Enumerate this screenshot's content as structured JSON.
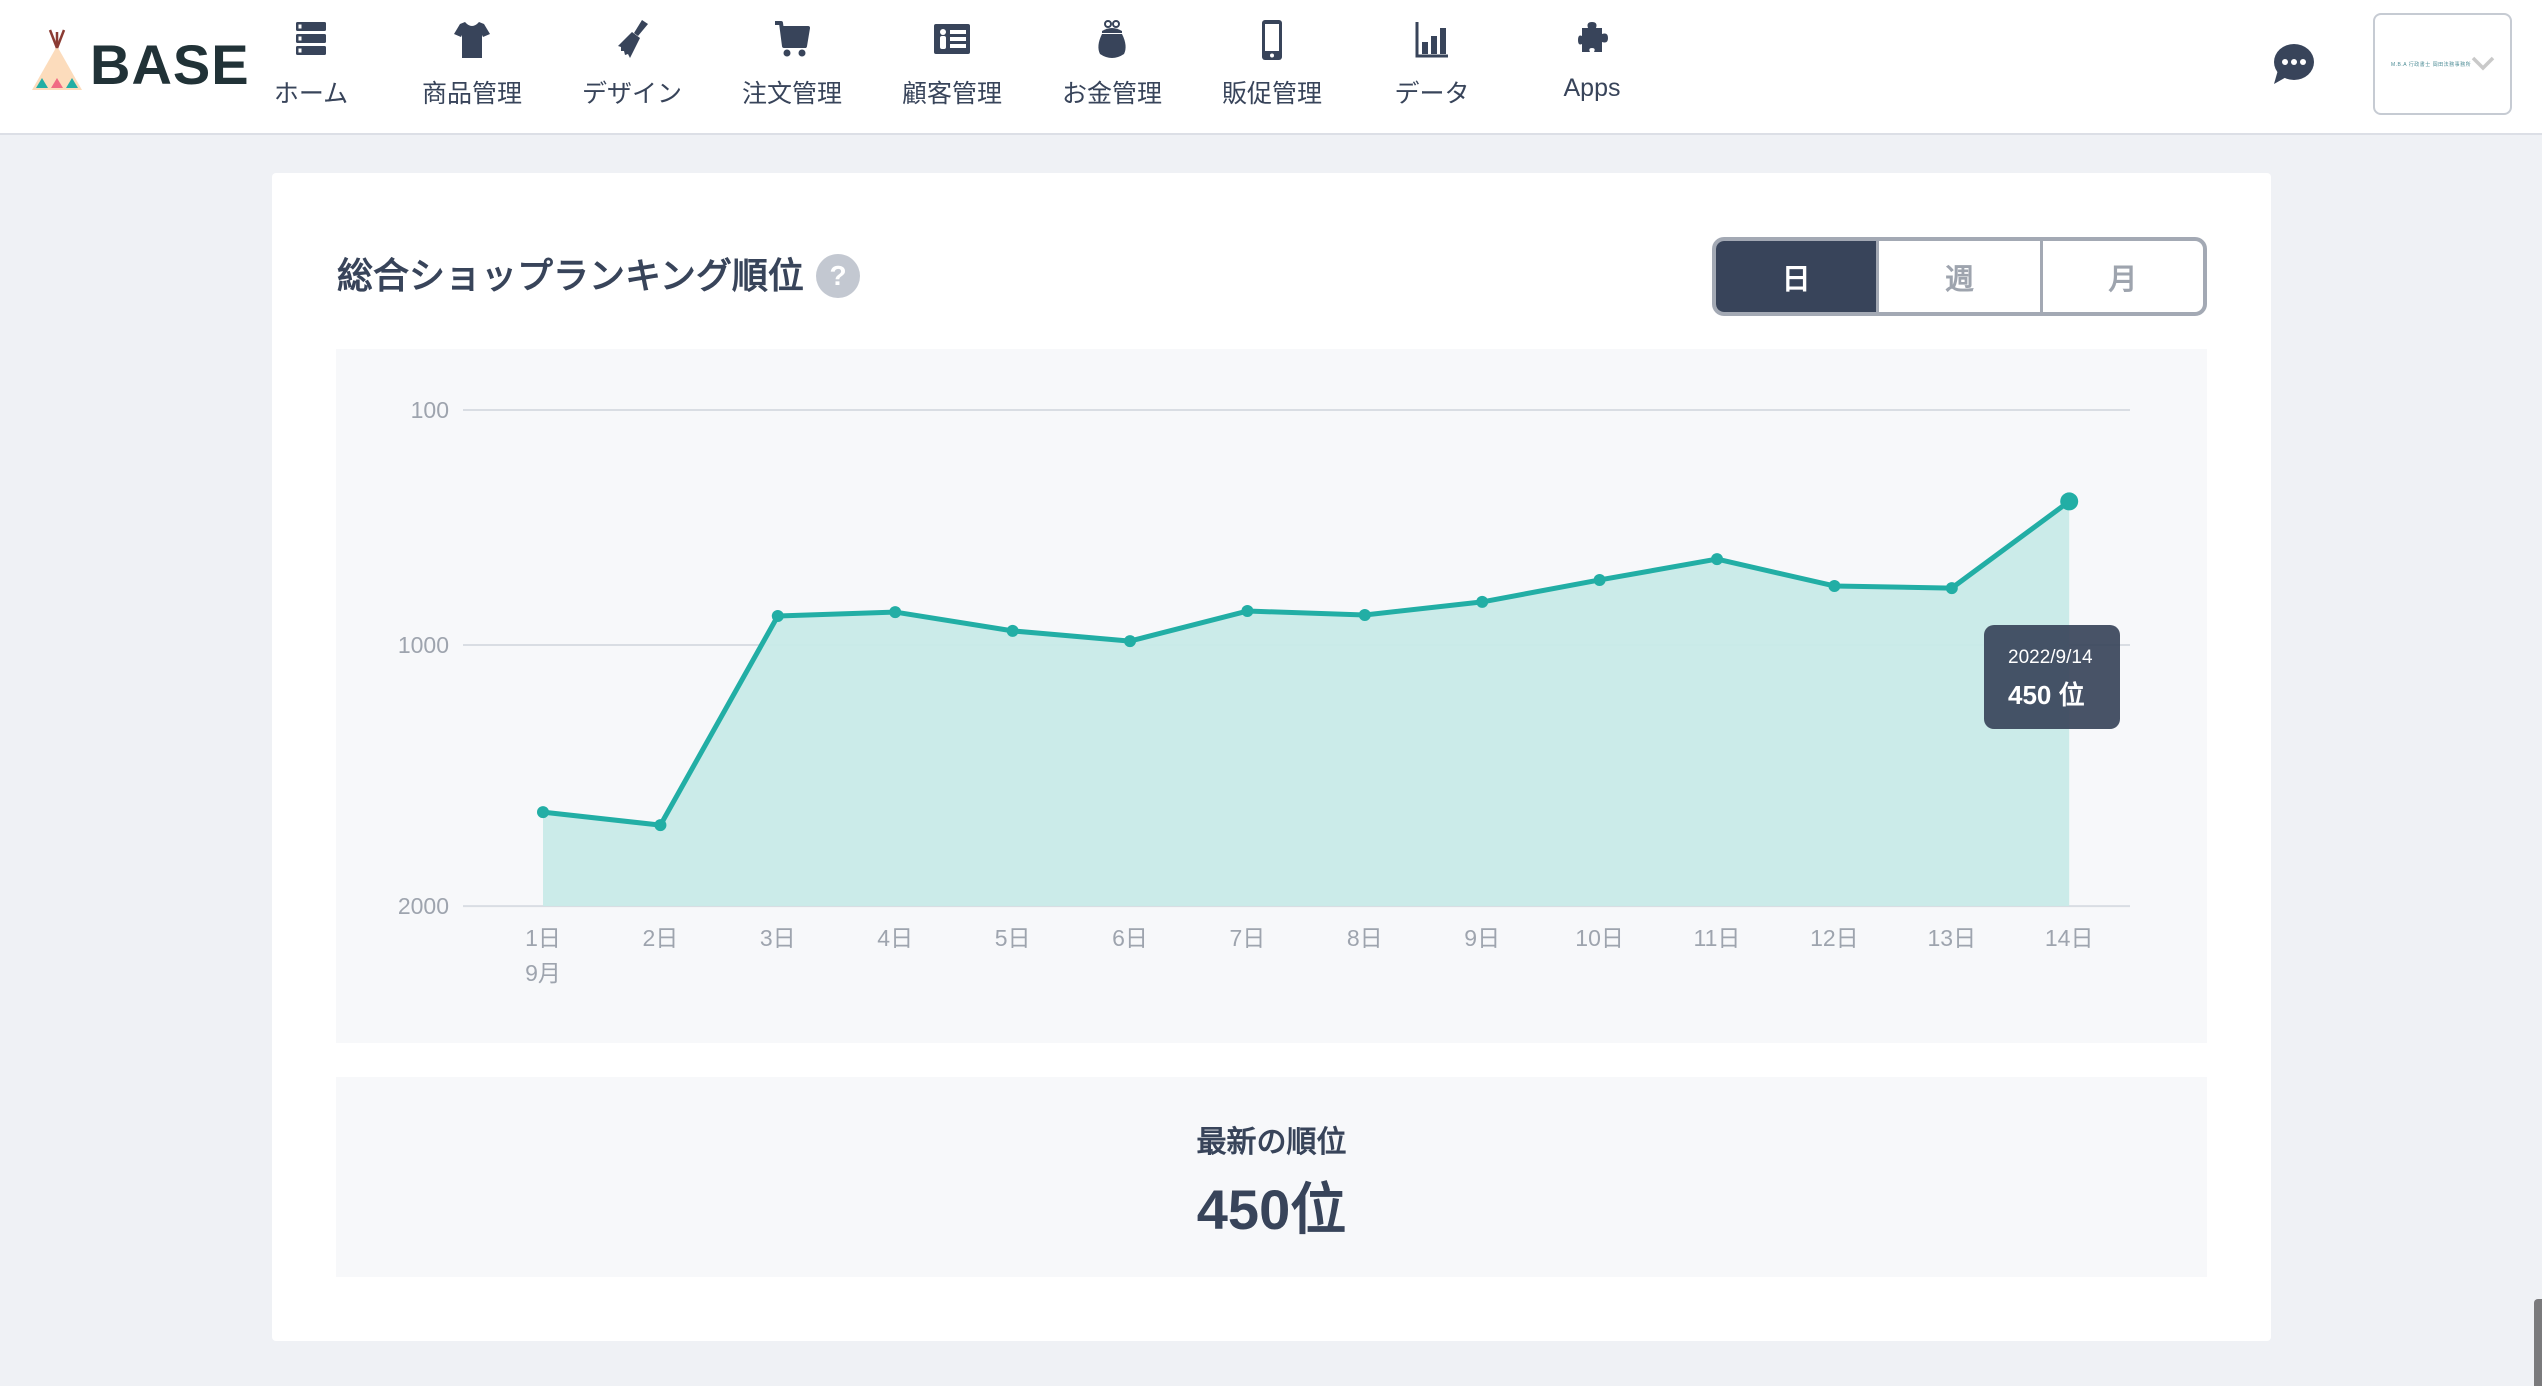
{
  "header": {
    "logo_text": "BASE",
    "nav": [
      {
        "id": "home",
        "label": "ホーム",
        "icon": "server-stack-icon"
      },
      {
        "id": "items",
        "label": "商品管理",
        "icon": "tshirt-icon"
      },
      {
        "id": "design",
        "label": "デザイン",
        "icon": "paintbrush-icon"
      },
      {
        "id": "orders",
        "label": "注文管理",
        "icon": "cart-icon"
      },
      {
        "id": "customers",
        "label": "顧客管理",
        "icon": "id-card-icon"
      },
      {
        "id": "money",
        "label": "お金管理",
        "icon": "purse-icon"
      },
      {
        "id": "promotion",
        "label": "販促管理",
        "icon": "smartphone-icon"
      },
      {
        "id": "data",
        "label": "データ",
        "icon": "bar-chart-icon"
      },
      {
        "id": "apps",
        "label": "Apps",
        "icon": "puzzle-icon"
      }
    ],
    "chat_icon": "chat-bubble-icon",
    "shop_name": "M.B.A 行政書士 岡田法務事務所"
  },
  "card": {
    "title": "総合ショップランキング順位",
    "help_label": "?",
    "period_tabs": [
      {
        "label": "日",
        "active": true
      },
      {
        "label": "週",
        "active": false
      },
      {
        "label": "月",
        "active": false
      }
    ],
    "tooltip": {
      "date": "2022/9/14",
      "value": "450 位"
    },
    "latest": {
      "label": "最新の順位",
      "value": "450位"
    }
  },
  "colors": {
    "line": "#22aea5",
    "area": "#c8eae8",
    "text_dark": "#38445a",
    "axis_text": "#9ea4ae"
  },
  "chart_data": {
    "type": "area",
    "title": "総合ショップランキング順位",
    "xlabel": "9月",
    "ylabel": "",
    "y_inverted": true,
    "ylim": [
      2000,
      100
    ],
    "yticks": [
      100,
      1000,
      2000
    ],
    "grid": true,
    "categories": [
      "1日",
      "2日",
      "3日",
      "4日",
      "5日",
      "6日",
      "7日",
      "8日",
      "9日",
      "10日",
      "11日",
      "12日",
      "13日",
      "14日"
    ],
    "x_sublabel": {
      "index": 0,
      "text": "9月"
    },
    "series": [
      {
        "name": "順位",
        "values": [
          1640,
          1690,
          889,
          874,
          946,
          985,
          870,
          885,
          835,
          751,
          671,
          774,
          782,
          450
        ]
      }
    ],
    "highlighted_point": {
      "index": 13,
      "date": "2022/9/14",
      "value": 450
    }
  }
}
